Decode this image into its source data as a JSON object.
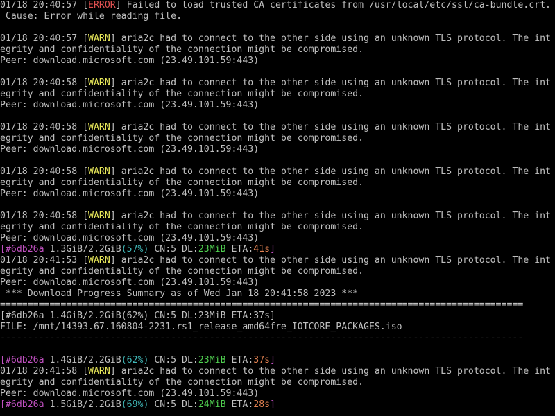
{
  "colors": {
    "background": "#000000",
    "text": "#bfbfbf",
    "error": "#e05050",
    "warn": "#e8e85a",
    "gid": "#c050c0",
    "percent": "#40b8b8",
    "speed": "#50d050",
    "eta": "#e08050"
  },
  "log": {
    "error": {
      "time": "01/18 20:40:57 [",
      "tag": "ERROR",
      "msg": "] Failed to load trusted CA certificates from /usr/local/etc/ssl/ca-bundle.crt.",
      "cause": " Cause: Error while reading file."
    },
    "warn_blocks": [
      {
        "time": "01/18 20:40:57 [",
        "tag": "WARN",
        "msg": "] aria2c had to connect to the other side using an unknown TLS protocol. The int",
        "line2": "egrity and confidentiality of the connection might be compromised.",
        "peer": "Peer: download.microsoft.com (23.49.101.59:443)"
      },
      {
        "time": "01/18 20:40:58 [",
        "tag": "WARN",
        "msg": "] aria2c had to connect to the other side using an unknown TLS protocol. The int",
        "line2": "egrity and confidentiality of the connection might be compromised.",
        "peer": "Peer: download.microsoft.com (23.49.101.59:443)"
      },
      {
        "time": "01/18 20:40:58 [",
        "tag": "WARN",
        "msg": "] aria2c had to connect to the other side using an unknown TLS protocol. The int",
        "line2": "egrity and confidentiality of the connection might be compromised.",
        "peer": "Peer: download.microsoft.com (23.49.101.59:443)"
      },
      {
        "time": "01/18 20:40:58 [",
        "tag": "WARN",
        "msg": "] aria2c had to connect to the other side using an unknown TLS protocol. The int",
        "line2": "egrity and confidentiality of the connection might be compromised.",
        "peer": "Peer: download.microsoft.com (23.49.101.59:443)"
      },
      {
        "time": "01/18 20:40:58 [",
        "tag": "WARN",
        "msg": "] aria2c had to connect to the other side using an unknown TLS protocol. The int",
        "line2": "egrity and confidentiality of the connection might be compromised.",
        "peer": "Peer: download.microsoft.com (23.49.101.59:443)"
      }
    ],
    "progress1": {
      "open": "[",
      "gid": "#6db26a",
      "size": " 1.3GiB/2.2GiB",
      "pct": "(57%)",
      "cn": " CN:5 DL:",
      "speed": "23MiB",
      "eta_label": " ETA:",
      "eta": "41s",
      "close": "]"
    },
    "warn6": {
      "time": "01/18 20:41:53 [",
      "tag": "WARN",
      "msg": "] aria2c had to connect to the other side using an unknown TLS protocol. The int",
      "line2": "egrity and confidentiality of the connection might be compromised.",
      "peer": "Peer: download.microsoft.com (23.49.101.59:443)"
    },
    "summary": {
      "header": " *** Download Progress Summary as of Wed Jan 18 20:41:58 2023 ***",
      "rule_double": "===============================================================================================",
      "status": "[#6db26a 1.4GiB/2.2GiB(62%) CN:5 DL:23MiB ETA:37s]",
      "file": "FILE: /mnt/14393.67.160804-2231.rs1_release_amd64fre_IOTCORE_PACKAGES.iso",
      "rule_single": "-----------------------------------------------------------------------------------------------"
    },
    "progress2": {
      "open": "[",
      "gid": "#6db26a",
      "size": " 1.4GiB/2.2GiB",
      "pct": "(62%)",
      "cn": " CN:5 DL:",
      "speed": "23MiB",
      "eta_label": " ETA:",
      "eta": "37s",
      "close": "]"
    },
    "warn7": {
      "time": "01/18 20:41:58 [",
      "tag": "WARN",
      "msg": "] aria2c had to connect to the other side using an unknown TLS protocol. The int",
      "line2": "egrity and confidentiality of the connection might be compromised.",
      "peer": "Peer: download.microsoft.com (23.49.101.59:443)"
    },
    "progress3": {
      "open": "[",
      "gid": "#6db26a",
      "size": " 1.5GiB/2.2GiB",
      "pct": "(69%)",
      "cn": " CN:5 DL:",
      "speed": "24MiB",
      "eta_label": " ETA:",
      "eta": "28s",
      "close": "]"
    }
  }
}
